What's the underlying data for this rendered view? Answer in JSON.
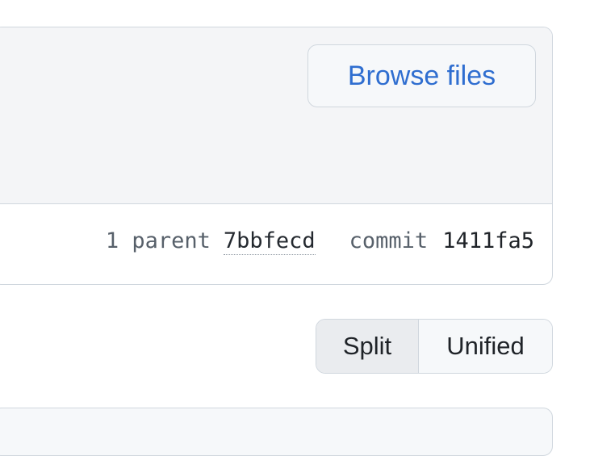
{
  "commit_box": {
    "browse_files_label": "Browse files",
    "parent_count_label": "1 parent",
    "parent_sha": "7bbfecd",
    "commit_label": "commit",
    "commit_sha": "1411fa5"
  },
  "diff_view": {
    "options": [
      {
        "label": "Split",
        "selected": true
      },
      {
        "label": "Unified",
        "selected": false
      }
    ]
  },
  "colors": {
    "link_blue": "#2f6ed0",
    "border": "#d0d7de",
    "header_bg": "#f4f5f7"
  }
}
